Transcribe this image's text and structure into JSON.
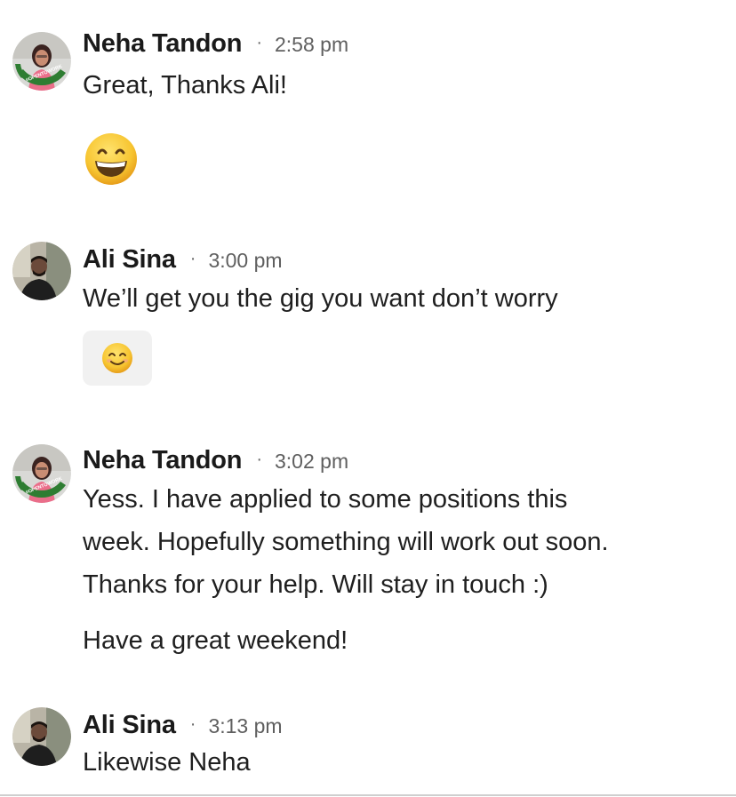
{
  "messages": [
    {
      "sender": "Neha Tandon",
      "time": "2:58 pm",
      "avatar_icon": "profile-photo-opentowork",
      "avatar_badge_text": "#OPENTOWORK",
      "text": "Great, Thanks Ali!",
      "emoji": "grinning-face-with-smiling-eyes-icon"
    },
    {
      "sender": "Ali Sina",
      "time": "3:00 pm",
      "avatar_icon": "profile-photo",
      "text": "We’ll get you the gig you want don’t worry",
      "reaction_emoji": "smiling-face-with-smiling-eyes-icon"
    },
    {
      "sender": "Neha Tandon",
      "time": "3:02 pm",
      "avatar_icon": "profile-photo-opentowork",
      "avatar_badge_text": "#OPENTOWORK",
      "lines": [
        "Yess. I have applied to some positions this",
        "week. Hopefully something will work out soon.",
        "Thanks for your help. Will stay in touch :)"
      ],
      "text2": "Have a great weekend!"
    },
    {
      "sender": "Ali Sina",
      "time": "3:13 pm",
      "avatar_icon": "profile-photo",
      "text": "Likewise Neha"
    }
  ],
  "separator_dot": "·",
  "colors": {
    "opentowork_green": "#2e7d32",
    "reaction_bg": "#f1f1f1",
    "emoji_yellow": "#f7c531"
  }
}
